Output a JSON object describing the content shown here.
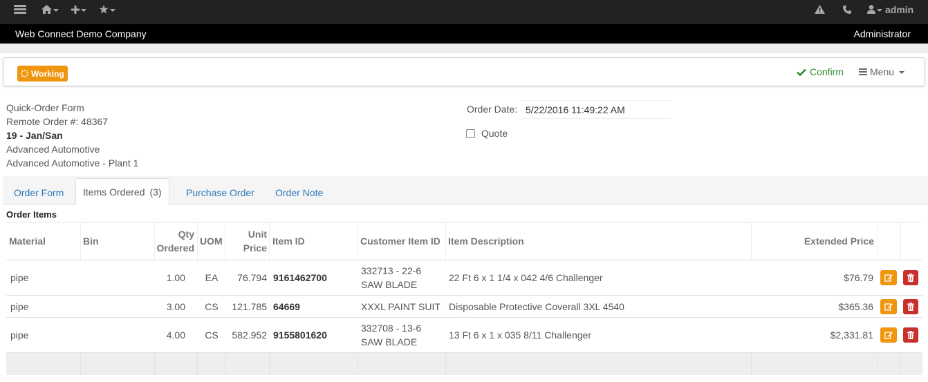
{
  "navbar": {
    "user": "admin",
    "icons": [
      "menu-icon",
      "home-icon",
      "plus-icon",
      "star-icon",
      "warning-icon",
      "phone-icon",
      "user-icon"
    ]
  },
  "company_bar": {
    "company": "Web Connect Demo Company",
    "role": "Administrator"
  },
  "toolbar": {
    "status_badge": "Working",
    "confirm_label": "Confirm",
    "menu_label": "Menu",
    "colors": {
      "badge": "#f0960e",
      "confirm": "#2e8b2e"
    }
  },
  "order_info": {
    "form_name": "Quick-Order Form",
    "remote_order": "Remote Order #: 48367",
    "salesperson": "19 - Jan/San",
    "customer": "Advanced Automotive",
    "ship_to": "Advanced Automotive - Plant 1",
    "order_date_label": "Order Date:",
    "order_date_value": "5/22/2016 11:49:22 AM",
    "quote_label": "Quote"
  },
  "tabs": [
    {
      "label": "Order Form"
    },
    {
      "label": "Items Ordered",
      "count": "(3)"
    },
    {
      "label": "Purchase Order"
    },
    {
      "label": "Order Note"
    }
  ],
  "section_title": "Order Items",
  "table": {
    "headers": {
      "material": "Material",
      "bin": "Bin",
      "qty_1": "Qty",
      "qty_2": "Ordered",
      "uom": "UOM",
      "price_1": "Unit",
      "price_2": "Price",
      "item_id": "Item ID",
      "customer_item_id": "Customer Item ID",
      "description": "Item Description",
      "extended_price": "Extended Price"
    },
    "rows": [
      {
        "material": "pipe",
        "bin": "",
        "qty": "1.00",
        "uom": "EA",
        "unit_price": "76.794",
        "item_id": "9161462700",
        "customer_item_id_1": "332713 - 22-6",
        "customer_item_id_2": "SAW BLADE",
        "description": "22 Ft 6 x 1 1/4 x 042 4/6 Challenger",
        "extended_price": "$76.79"
      },
      {
        "material": "pipe",
        "bin": "",
        "qty": "3.00",
        "uom": "CS",
        "unit_price": "121.785",
        "item_id": "64669",
        "customer_item_id_1": "XXXL PAINT SUIT",
        "customer_item_id_2": "",
        "description": "Disposable Protective Coverall 3XL 4540",
        "extended_price": "$365.36"
      },
      {
        "material": "pipe",
        "bin": "",
        "qty": "4.00",
        "uom": "CS",
        "unit_price": "582.952",
        "item_id": "9155801620",
        "customer_item_id_1": "332708 - 13-6",
        "customer_item_id_2": "SAW BLADE",
        "description": "13 Ft 6 x 1 x 035 8/11 Challenger",
        "extended_price": "$2,331.81"
      }
    ]
  }
}
